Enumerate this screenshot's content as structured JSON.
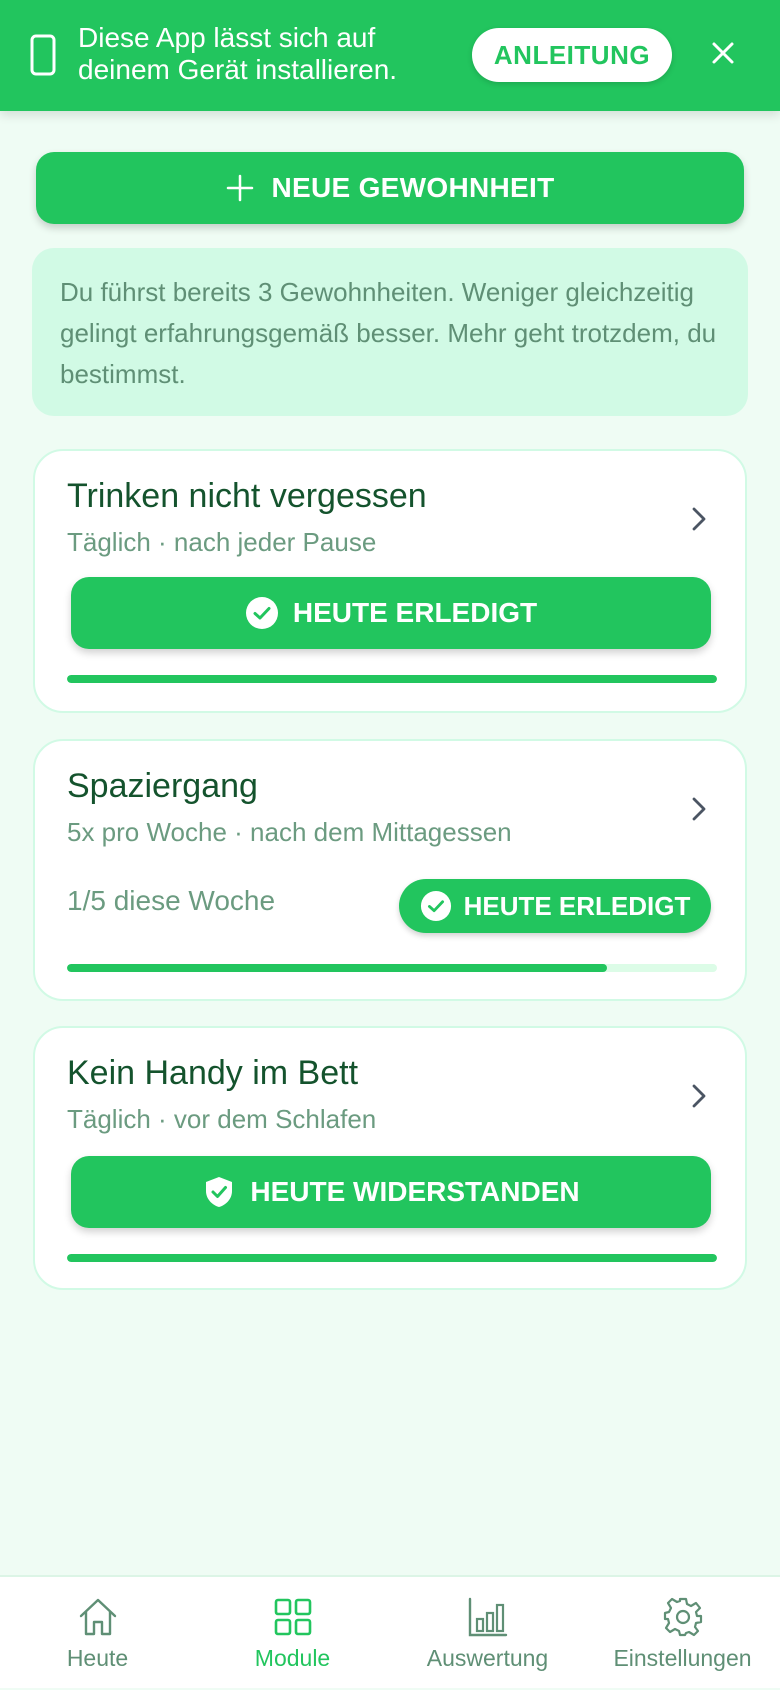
{
  "install_banner": {
    "text_line1": "Diese App lässt sich auf",
    "text_line2": "deinem Gerät installieren.",
    "button_label": "ANLEITUNG"
  },
  "new_habit_button": {
    "label": "NEUE GEWOHNHEIT"
  },
  "info_box": {
    "text": "Du führst bereits 3 Gewohnheiten. Weniger gleichzeitig gelingt erfahrungsgemäß besser. Mehr geht trotzdem, du bestimmst."
  },
  "habits": [
    {
      "title": "Trinken nicht vergessen",
      "subtitle": "Täglich · nach jeder Pause",
      "action_label": "HEUTE ERLEDIGT",
      "action_icon": "check-circle-icon",
      "progress": 1.0
    },
    {
      "title": "Spaziergang",
      "subtitle": "5x pro Woche · nach dem Mittagessen",
      "week_count": "1/5 diese Woche",
      "action_label": "HEUTE ERLEDIGT",
      "action_icon": "check-circle-icon",
      "progress": 0.83
    },
    {
      "title": "Kein Handy im Bett",
      "subtitle": "Täglich · vor dem Schlafen",
      "action_label": "HEUTE WIDERSTANDEN",
      "action_icon": "shield-check-icon",
      "progress": 1.0
    }
  ],
  "bottom_nav": {
    "items": [
      {
        "label": "Heute",
        "icon": "home-icon",
        "active": false
      },
      {
        "label": "Module",
        "icon": "grid-icon",
        "active": true
      },
      {
        "label": "Auswertung",
        "icon": "bar-chart-icon",
        "active": false
      },
      {
        "label": "Einstellungen",
        "icon": "gear-icon",
        "active": false
      }
    ]
  },
  "colors": {
    "accent": "#22c55e",
    "background": "#effcf4",
    "info_bg": "#d1fae5",
    "text_dark": "#14532d",
    "text_muted": "#6b9b80"
  }
}
